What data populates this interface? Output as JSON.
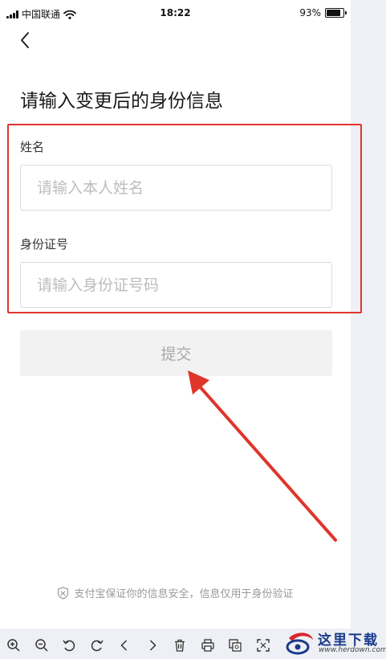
{
  "status_bar": {
    "carrier": "中国联通",
    "time": "18:22",
    "battery_percent": "93%",
    "battery_level": 0.93
  },
  "page": {
    "title": "请输入变更后的身份信息"
  },
  "form": {
    "name_label": "姓名",
    "name_placeholder": "请输入本人姓名",
    "id_label": "身份证号",
    "id_placeholder": "请输入身份证号码",
    "submit_label": "提交"
  },
  "footer": {
    "security_note": "支付宝保证你的信息安全，信息仅用于身份验证"
  },
  "watermark": {
    "text": "这里下载",
    "url": "www.herdown.com"
  },
  "colors": {
    "annotation": "#e0352b",
    "submit_disabled_bg": "#f2f2f2",
    "watermark": "#1a3a8a"
  },
  "toolbar": {
    "tools": [
      "zoom-in-icon",
      "zoom-out-icon",
      "rotate-left-icon",
      "rotate-right-icon",
      "previous-icon",
      "next-icon",
      "delete-icon",
      "print-icon",
      "copy-icon",
      "fullscreen-icon"
    ]
  }
}
